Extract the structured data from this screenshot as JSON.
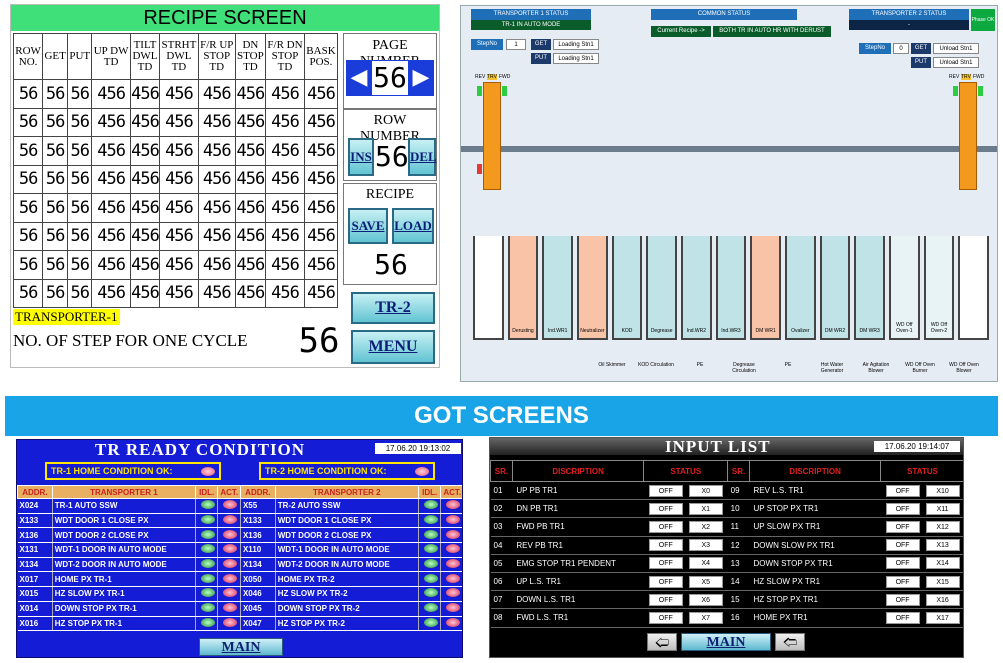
{
  "recipe": {
    "title": "RECIPE SCREEN",
    "headers": [
      [
        "ROW",
        "NO."
      ],
      [
        "GET"
      ],
      [
        "PUT"
      ],
      [
        "UP DW",
        "TD"
      ],
      [
        "TILT",
        "DWL",
        "TD"
      ],
      [
        "STRHT",
        "DWL",
        "TD"
      ],
      [
        "F/R UP",
        "STOP",
        "TD"
      ],
      [
        "DN",
        "STOP",
        "TD"
      ],
      [
        "F/R DN",
        "STOP",
        "TD"
      ],
      [
        "BASK",
        "POS."
      ]
    ],
    "rows": [
      [
        "56",
        "56",
        "56",
        "456",
        "456",
        "456",
        "456",
        "456",
        "456",
        "456"
      ],
      [
        "56",
        "56",
        "56",
        "456",
        "456",
        "456",
        "456",
        "456",
        "456",
        "456"
      ],
      [
        "56",
        "56",
        "56",
        "456",
        "456",
        "456",
        "456",
        "456",
        "456",
        "456"
      ],
      [
        "56",
        "56",
        "56",
        "456",
        "456",
        "456",
        "456",
        "456",
        "456",
        "456"
      ],
      [
        "56",
        "56",
        "56",
        "456",
        "456",
        "456",
        "456",
        "456",
        "456",
        "456"
      ],
      [
        "56",
        "56",
        "56",
        "456",
        "456",
        "456",
        "456",
        "456",
        "456",
        "456"
      ],
      [
        "56",
        "56",
        "56",
        "456",
        "456",
        "456",
        "456",
        "456",
        "456",
        "456"
      ],
      [
        "56",
        "56",
        "56",
        "456",
        "456",
        "456",
        "456",
        "456",
        "456",
        "456"
      ]
    ],
    "page_number_label": "PAGE NUMBER",
    "page_number_value": "56",
    "row_number_label": "ROW NUMBER",
    "row_number_value": "56",
    "ins_label": "INS",
    "del_label": "DEL",
    "recipe_label": "RECIPE",
    "save_label": "SAVE",
    "load_label": "LOAD",
    "recipe_value": "56",
    "transporter_label": "TRANSPORTER-1",
    "steps_label": "NO. OF STEP FOR ONE CYCLE",
    "steps_value": "56",
    "tr2_label": "TR-2",
    "menu_label": "MENU"
  },
  "transporter_status": {
    "tr1_title": "TRANSPORTER 1 STATUS",
    "tr1_mode": "TR-1 IN AUTO MODE",
    "common_title": "COMMON STATUS",
    "current_recipe_label": "Current Recipe ->",
    "current_recipe_value": "BOTH TR IN AUTO HR WITH DERUST",
    "tr2_title": "TRANSPORTER 2 STATUS",
    "tr2_mode": "-",
    "phase_label": "Phase OK",
    "stepno_label": "StepNo",
    "tr1_stepno": "1",
    "tr2_stepno": "0",
    "get_label": "GET",
    "put_label": "PUT",
    "tr1_get": "Loading Stn1",
    "tr1_put": "Loading Stn1",
    "tr2_get": "Unload Stn1",
    "tr2_put": "Unload Stn1",
    "rev_label": "REV",
    "trv_label": "TRV",
    "fwd_label": "FWD",
    "tanks": [
      "",
      "Derusting",
      "Ind.WR1",
      "Neutralizer",
      "KOD",
      "Degrease",
      "Ind.WR2",
      "Ind.WR3",
      "DM WR1",
      "Ovalizer",
      "DM WR2",
      "DM WR3",
      "WD Off Oven-1",
      "WD Off Oven-2",
      ""
    ],
    "equipment": [
      "Oil Skimmer",
      "KOD Circulation",
      "PE",
      "Degrease Circulation",
      "PE",
      "Hot Water Generator",
      "Air Agitation Blower",
      "WD Off Oven Burner",
      "WD Off Oven Blower"
    ]
  },
  "banner": "GOT SCREENS",
  "tr_ready": {
    "title": "TR READY CONDITION",
    "datetime": "17.06.20 19:13:02",
    "tr1_home": "TR-1 HOME CONDITION OK:",
    "tr2_home": "TR-2 HOME CONDITION OK:",
    "headers": [
      "ADDR.",
      "TRANSPORTER 1",
      "IDL.",
      "ACT.",
      "ADDR.",
      "TRANSPORTER 2",
      "IDL.",
      "ACT."
    ],
    "rows": [
      [
        "X024",
        "TR-1 AUTO SSW",
        "X55",
        "TR-2 AUTO SSW"
      ],
      [
        "X133",
        "WDT DOOR 1 CLOSE PX",
        "X133",
        "WDT DOOR 1 CLOSE PX"
      ],
      [
        "X136",
        "WDT DOOR 2 CLOSE PX",
        "X136",
        "WDT DOOR 2 CLOSE PX"
      ],
      [
        "X131",
        "WDT-1 DOOR IN AUTO MODE",
        "X110",
        "WDT-1 DOOR IN AUTO MODE"
      ],
      [
        "X134",
        "WDT-2 DOOR IN AUTO MODE",
        "X134",
        "WDT-2 DOOR IN AUTO MODE"
      ],
      [
        "X017",
        "HOME PX TR-1",
        "X050",
        "HOME PX TR-2"
      ],
      [
        "X015",
        "HZ SLOW PX TR-1",
        "X046",
        "HZ SLOW PX TR-2"
      ],
      [
        "X014",
        "DOWN STOP PX TR-1",
        "X045",
        "DOWN STOP PX TR-2"
      ],
      [
        "X016",
        "HZ STOP PX TR-1",
        "X047",
        "HZ STOP PX TR-2"
      ]
    ],
    "main_label": "MAIN"
  },
  "input_list": {
    "title": "INPUT LIST",
    "datetime": "17.06.20 19:14:07",
    "headers": [
      "SR.",
      "DISCRIPTION",
      "STATUS",
      "SR.",
      "DISCRIPTION",
      "STATUS"
    ],
    "left": [
      [
        "01",
        "UP PB TR1",
        "OFF",
        "X0"
      ],
      [
        "02",
        "DN PB TR1",
        "OFF",
        "X1"
      ],
      [
        "03",
        "FWD PB TR1",
        "OFF",
        "X2"
      ],
      [
        "04",
        "REV PB TR1",
        "OFF",
        "X3"
      ],
      [
        "05",
        "EMG STOP TR1 PENDENT",
        "OFF",
        "X4"
      ],
      [
        "06",
        "UP L.S. TR1",
        "OFF",
        "X5"
      ],
      [
        "07",
        "DOWN L.S. TR1",
        "OFF",
        "X6"
      ],
      [
        "08",
        "FWD L.S. TR1",
        "OFF",
        "X7"
      ]
    ],
    "right": [
      [
        "09",
        "REV L.S. TR1",
        "OFF",
        "X10"
      ],
      [
        "10",
        "UP STOP PX TR1",
        "OFF",
        "X11"
      ],
      [
        "11",
        "UP SLOW PX TR1",
        "OFF",
        "X12"
      ],
      [
        "12",
        "DOWN SLOW PX TR1",
        "OFF",
        "X13"
      ],
      [
        "13",
        "DOWN STOP PX TR1",
        "OFF",
        "X14"
      ],
      [
        "14",
        "HZ SLOW PX TR1",
        "OFF",
        "X15"
      ],
      [
        "15",
        "HZ STOP PX TR1",
        "OFF",
        "X16"
      ],
      [
        "16",
        "HOME PX TR1",
        "OFF",
        "X17"
      ]
    ],
    "main_label": "MAIN"
  },
  "colors": {
    "recipe_title_bg": "#3fe07a",
    "page_arrow_bg": "#1a3cd8",
    "banner_bg": "#18a4e6",
    "tr_ready_bg": "#141cd6",
    "indicator_green": "#1e8a35",
    "indicator_red": "#d12656"
  },
  "icons": {
    "page_prev": "left-arrow-icon",
    "page_next": "right-arrow-icon",
    "nav_prev": "left-arrow-icon",
    "nav_next": "right-arrow-icon"
  }
}
